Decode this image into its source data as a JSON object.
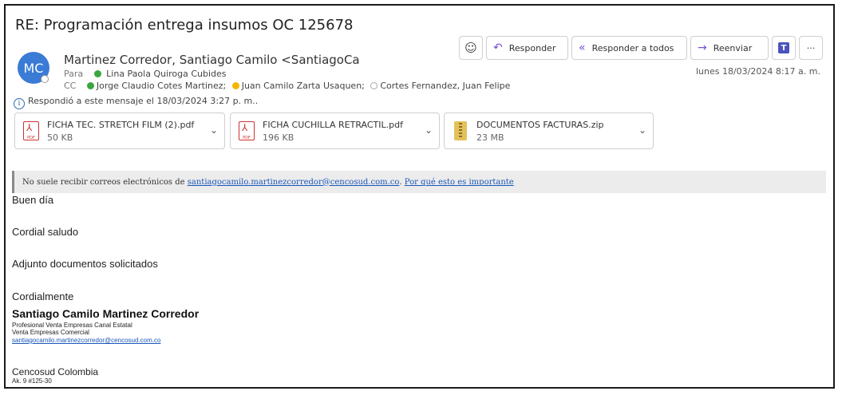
{
  "subject": "RE: Programación entrega insumos OC 125678",
  "sender": {
    "initials": "MC",
    "display": "Martinez Corredor, Santiago Camilo <SantiagoCa"
  },
  "to": {
    "label": "Para",
    "recipients": [
      "Lina Paola Quiroga Cubides"
    ]
  },
  "cc": {
    "label": "CC",
    "recipients": [
      "Jorge Claudio Cotes Martinez;",
      "Juan Camilo Zarta Usaquen;",
      "Cortes Fernandez, Juan Felipe"
    ]
  },
  "replied_notice": "Respondió a este mensaje el 18/03/2024 3:27 p. m..",
  "toolbar": {
    "reply": "Responder",
    "reply_all": "Responder a todos",
    "forward": "Reenviar",
    "more": "···"
  },
  "date": "lunes 18/03/2024 8:17 a. m.",
  "attachments": [
    {
      "name": "FICHA TEC. STRETCH FILM (2).pdf",
      "size": "50 KB",
      "type": "pdf"
    },
    {
      "name": "FICHA CUCHILLA RETRACTIL.pdf",
      "size": "196 KB",
      "type": "pdf"
    },
    {
      "name": "DOCUMENTOS FACTURAS.zip",
      "size": "23 MB",
      "type": "zip"
    }
  ],
  "warning": {
    "text": "No suele recibir correos electrónicos de",
    "email": "santiagocamilo.martinezcorredor@cencosud.com.co",
    "sep": ".",
    "link": "Por qué esto es importante"
  },
  "body": {
    "greeting": "Buen día",
    "salute": "Cordial saludo",
    "message": "Adjunto documentos solicitados",
    "closing": "Cordialmente"
  },
  "signature": {
    "name": "Santiago Camilo Martinez Corredor",
    "title": "Profesional Venta Empresas Canal Estatal",
    "dept": "Venta Empresas Comercial",
    "email": "santiagocamilo.martinezcorredor@cencosud.com.co",
    "company": "Cencosud Colombia",
    "address": "Ak. 9 #125-30"
  },
  "colors": {
    "avatar": "#3a7bd5",
    "accent_icon": "#7a4fd6",
    "link": "#1a56b8",
    "presence_green": "#3ba540",
    "presence_yellow": "#f4b400"
  }
}
